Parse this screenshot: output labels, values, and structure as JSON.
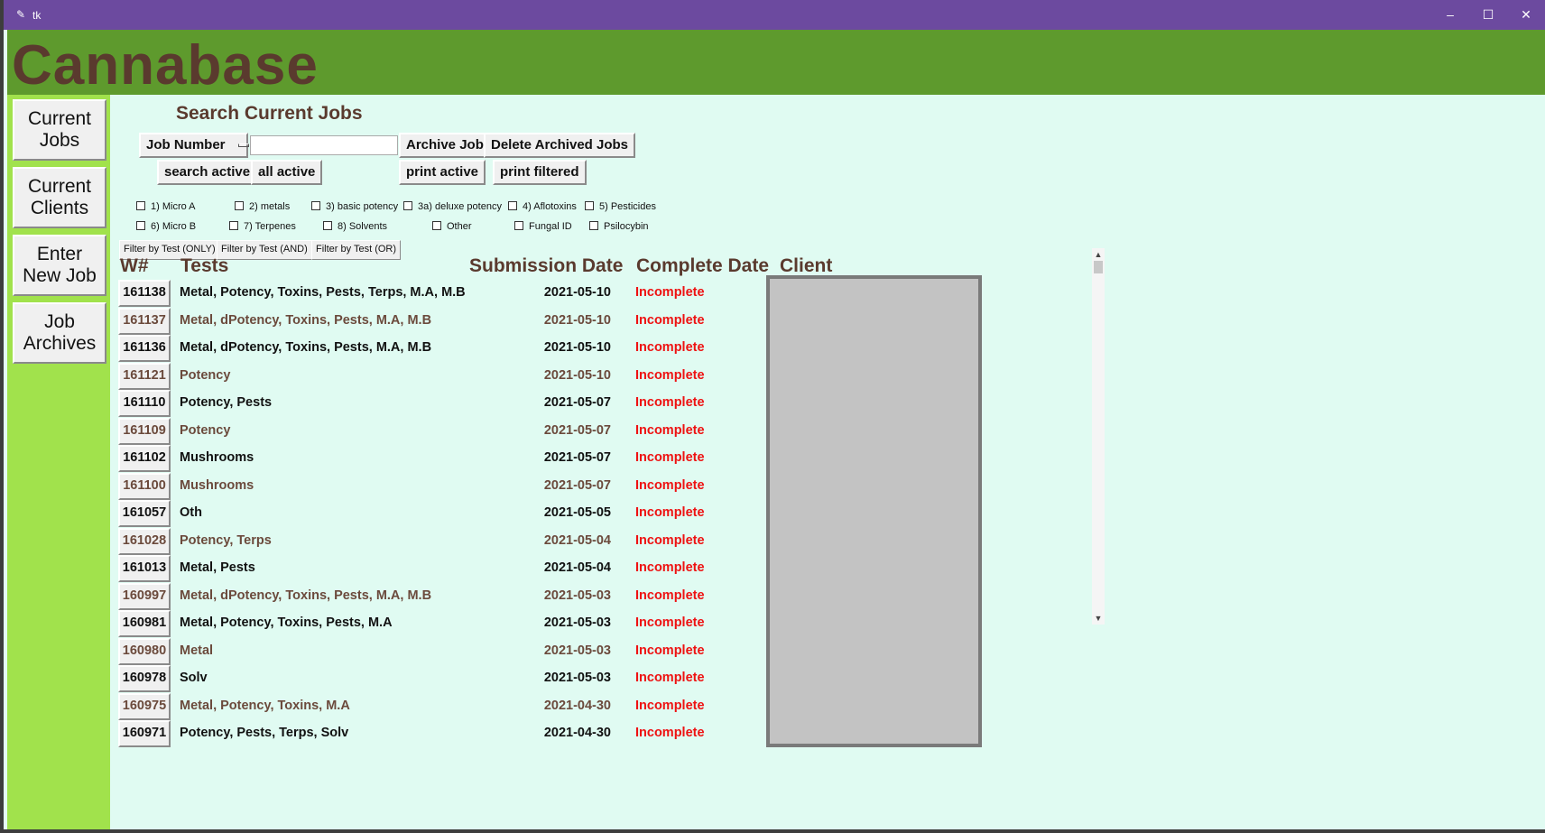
{
  "window": {
    "title": "tk",
    "minimize": "–",
    "maximize": "☐",
    "close": "✕",
    "icon": "feather-icon"
  },
  "header": {
    "brand": "Cannabase"
  },
  "sidebar": {
    "items": [
      {
        "label": "Current\nJobs"
      },
      {
        "label": "Current\nClients"
      },
      {
        "label": "Enter\nNew Job"
      },
      {
        "label": "Job\nArchives"
      }
    ]
  },
  "search": {
    "title": "Search Current Jobs",
    "field_select": "Job Number",
    "input_value": "",
    "archive_jobs": "Archive Jobs",
    "delete_archived": "Delete Archived Jobs",
    "search_active": "search active",
    "all_active": "all active",
    "print_active": "print active",
    "print_filtered": "print filtered"
  },
  "filters": {
    "checkboxes": [
      "1) Micro A",
      "2) metals",
      "3) basic potency",
      "3a) deluxe potency",
      "4) Aflotoxins",
      "5) Pesticides",
      "6) Micro B",
      "7) Terpenes",
      "8) Solvents",
      "Other",
      "Fungal ID",
      "Psilocybin"
    ],
    "buttons": [
      "Filter by Test (ONLY)",
      "Filter by Test (AND)",
      "Filter by Test (OR)"
    ]
  },
  "table": {
    "headers": {
      "w": "W#",
      "tests": "Tests",
      "submission": "Submission Date",
      "complete": "Complete Date",
      "client": "Client"
    },
    "rows": [
      {
        "w": "161138",
        "tests": "Metal, Potency, Toxins, Pests, Terps, M.A, M.B",
        "submitted": "2021-05-10",
        "complete": "Incomplete"
      },
      {
        "w": "161137",
        "tests": "Metal, dPotency, Toxins, Pests, M.A, M.B",
        "submitted": "2021-05-10",
        "complete": "Incomplete"
      },
      {
        "w": "161136",
        "tests": "Metal, dPotency, Toxins, Pests, M.A, M.B",
        "submitted": "2021-05-10",
        "complete": "Incomplete"
      },
      {
        "w": "161121",
        "tests": "Potency",
        "submitted": "2021-05-10",
        "complete": "Incomplete"
      },
      {
        "w": "161110",
        "tests": "Potency, Pests",
        "submitted": "2021-05-07",
        "complete": "Incomplete"
      },
      {
        "w": "161109",
        "tests": "Potency",
        "submitted": "2021-05-07",
        "complete": "Incomplete"
      },
      {
        "w": "161102",
        "tests": "Mushrooms",
        "submitted": "2021-05-07",
        "complete": "Incomplete"
      },
      {
        "w": "161100",
        "tests": "Mushrooms",
        "submitted": "2021-05-07",
        "complete": "Incomplete"
      },
      {
        "w": "161057",
        "tests": "Oth",
        "submitted": "2021-05-05",
        "complete": "Incomplete"
      },
      {
        "w": "161028",
        "tests": "Potency, Terps",
        "submitted": "2021-05-04",
        "complete": "Incomplete"
      },
      {
        "w": "161013",
        "tests": "Metal, Pests",
        "submitted": "2021-05-04",
        "complete": "Incomplete"
      },
      {
        "w": "160997",
        "tests": "Metal, dPotency, Toxins, Pests, M.A, M.B",
        "submitted": "2021-05-03",
        "complete": "Incomplete"
      },
      {
        "w": "160981",
        "tests": "Metal, Potency, Toxins, Pests, M.A",
        "submitted": "2021-05-03",
        "complete": "Incomplete"
      },
      {
        "w": "160980",
        "tests": "Metal",
        "submitted": "2021-05-03",
        "complete": "Incomplete"
      },
      {
        "w": "160978",
        "tests": "Solv",
        "submitted": "2021-05-03",
        "complete": "Incomplete"
      },
      {
        "w": "160975",
        "tests": "Metal, Potency, Toxins, M.A",
        "submitted": "2021-04-30",
        "complete": "Incomplete"
      },
      {
        "w": "160971",
        "tests": "Potency, Pests, Terps, Solv",
        "submitted": "2021-04-30",
        "complete": "Incomplete"
      }
    ]
  },
  "colors": {
    "titlebar": "#6c4a9f",
    "header": "#5e9a2d",
    "sidebar": "#a1e24c",
    "main_bg": "#e0fbf2",
    "brand_text": "#5a3a2e",
    "incomplete": "#ee1111"
  }
}
